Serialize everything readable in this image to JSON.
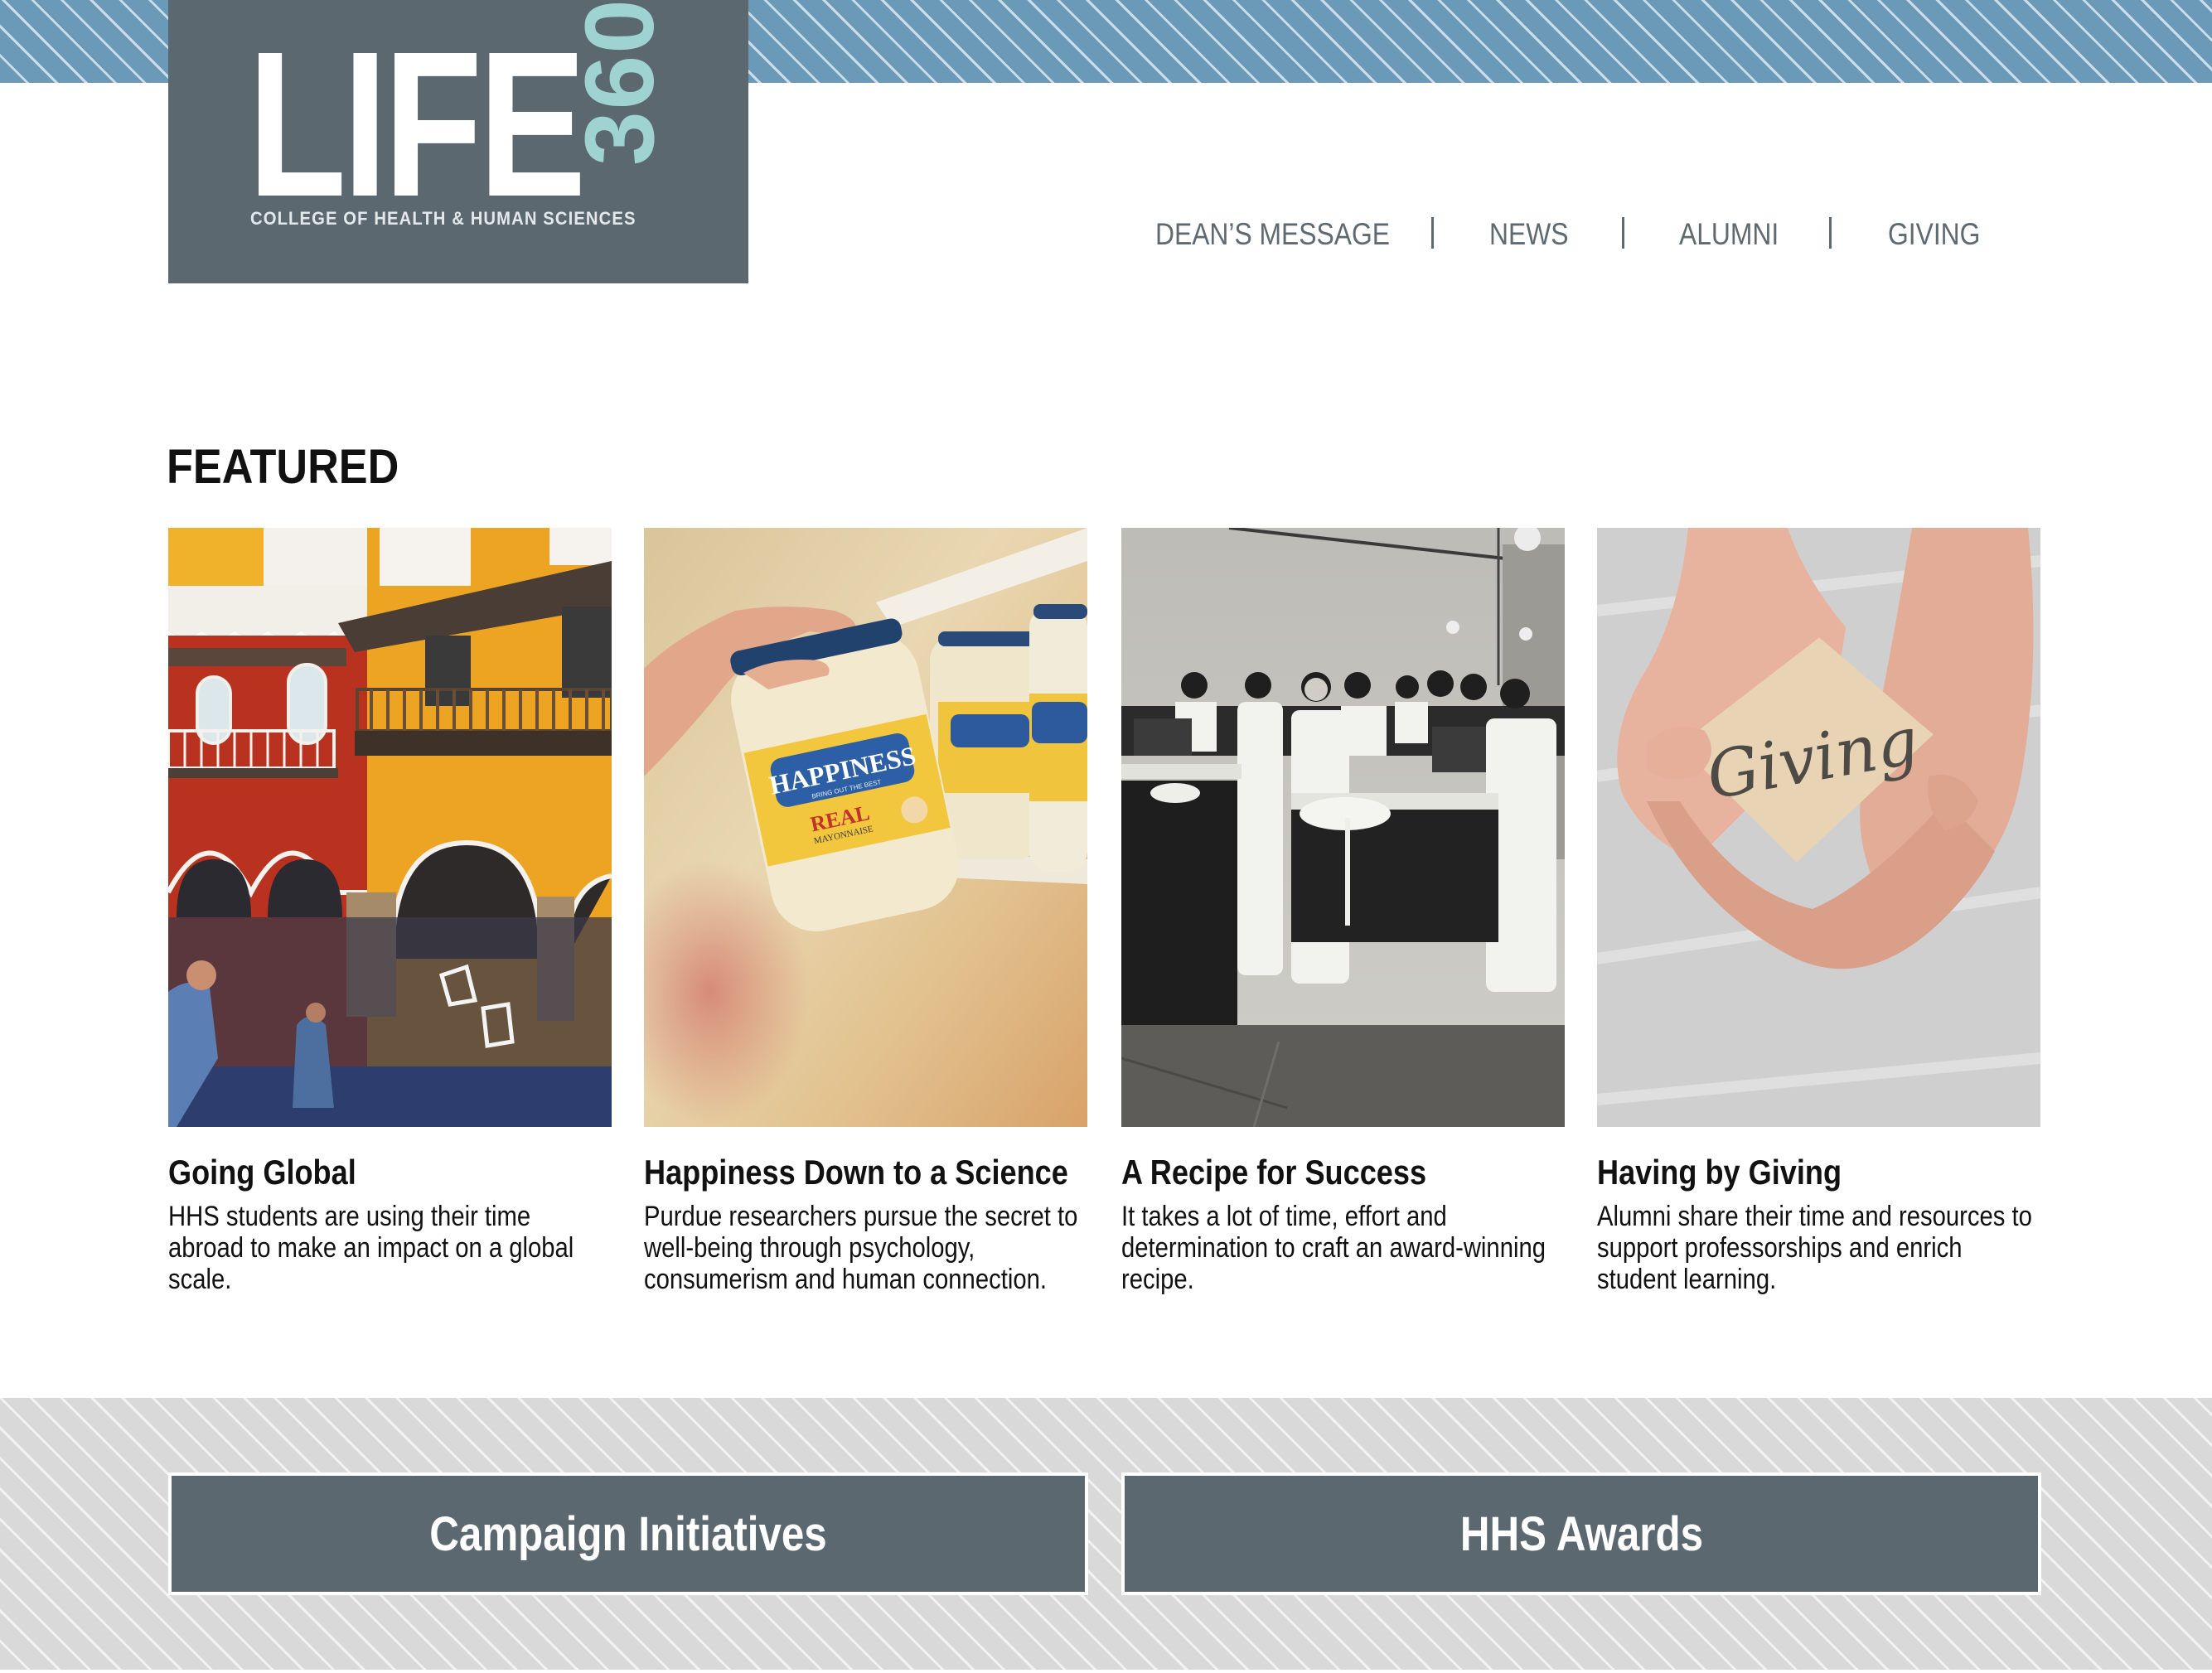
{
  "header": {
    "logo": {
      "wordmark": "LIFE",
      "number": "360",
      "subtitle": "COLLEGE OF HEALTH & HUMAN SCIENCES"
    },
    "nav": [
      {
        "label": "DEAN’S MESSAGE"
      },
      {
        "label": "NEWS"
      },
      {
        "label": "ALUMNI"
      },
      {
        "label": "GIVING"
      }
    ],
    "nav_separator": "|"
  },
  "featured": {
    "heading": "FEATURED",
    "cards": [
      {
        "title": "Going Global",
        "description": "HHS students are using their time abroad to make an impact on a global scale.",
        "image": "colorful colonial buildings with balconies and arches"
      },
      {
        "title": "Happiness Down to a Science",
        "description": "Purdue researchers pursue the secret to well-being through psychology, consumerism and human connection.",
        "image": "hand holding a mayonnaise jar labeled Happiness",
        "image_text": {
          "brand": "HAPPINESS",
          "tagline": "BRING OUT THE BEST",
          "product": "REAL",
          "product_sub": "MAYONNAISE"
        }
      },
      {
        "title": "A Recipe for Success",
        "description": "It takes a lot of time, effort and determination to craft an award-winning recipe.",
        "image": "black and white photo of women in aprons cooking in a kitchen classroom"
      },
      {
        "title": "Having by Giving",
        "description": "Alumni share their time and resources to support professorships and enrich student learning.",
        "image": "cupped hands holding a card reading Giving",
        "image_text": {
          "card": "Giving"
        }
      }
    ]
  },
  "cta": {
    "buttons": [
      {
        "label": "Campaign Initiatives"
      },
      {
        "label": "HHS Awards"
      }
    ]
  },
  "colors": {
    "brand_slate": "#5C6870",
    "brand_teal": "#9FD3D2",
    "stripe_blue": "#6B9AB8",
    "stripe_gray": "#D9D9D9",
    "nav_text": "#5F6A70",
    "body_text": "#111111"
  }
}
